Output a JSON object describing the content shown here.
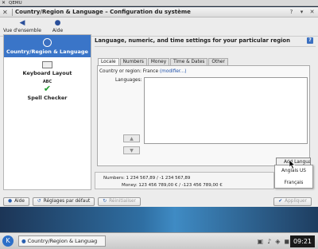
{
  "qemu": {
    "title": "QEMU"
  },
  "window": {
    "title": "Country/Region & Language – Configuration du système",
    "app_icon": "x-icon",
    "buttons": [
      "help-icon",
      "minimize-icon",
      "close-icon"
    ]
  },
  "toolbar": {
    "overview_label": "Vue d'ensemble",
    "help_label": "Aide"
  },
  "sidebar": {
    "items": [
      {
        "label": "Country/Region & Language",
        "icon": "globe-icon",
        "active": true
      },
      {
        "label": "Keyboard Layout",
        "icon": "keyboard-icon",
        "active": false
      },
      {
        "label": "Spell Checker",
        "icon": "spellcheck-icon",
        "active": false,
        "icon_text": "ABC"
      }
    ]
  },
  "main": {
    "heading": "Language, numeric, and time settings for your particular region",
    "tabs": [
      {
        "label": "Locale",
        "active": true
      },
      {
        "label": "Numbers",
        "active": false
      },
      {
        "label": "Money",
        "active": false
      },
      {
        "label": "Time & Dates",
        "active": false
      },
      {
        "label": "Other",
        "active": false
      }
    ],
    "country_label": "Country or region:",
    "country_value": "France",
    "modify_link": "(modifier...)",
    "languages_label": "Languages:",
    "add_button": "Add Langua",
    "dropdown": [
      "Anglais US",
      "Français"
    ],
    "examples": {
      "numbers": "Numbers: 1 234 567,89 / -1 234 567,89",
      "money": "Money: 123 456 789,00 € / -123 456 789,00 €"
    }
  },
  "bottom": {
    "help": "Aide",
    "defaults": "Réglages par défaut",
    "reset": "Réinitialiser",
    "apply": "Appliquer"
  },
  "taskbar": {
    "task_label": "Country/Region & Languag",
    "clock": "09:21"
  },
  "colors": {
    "accent": "#3a75c8"
  }
}
